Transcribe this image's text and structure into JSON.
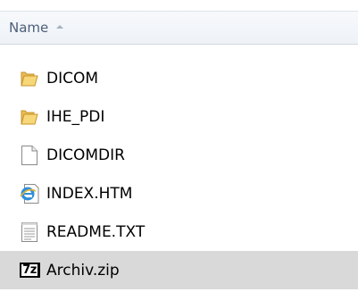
{
  "header": {
    "column_name": "Name"
  },
  "files": [
    {
      "name": "DICOM",
      "icon": "folder-icon"
    },
    {
      "name": "IHE_PDI",
      "icon": "folder-icon"
    },
    {
      "name": "DICOMDIR",
      "icon": "file-icon"
    },
    {
      "name": "INDEX.HTM",
      "icon": "html-file-icon"
    },
    {
      "name": "README.TXT",
      "icon": "text-file-icon"
    },
    {
      "name": "Archiv.zip",
      "icon": "7zip-archive-icon",
      "selected": true
    }
  ],
  "colors": {
    "selected_row": "#d9d9d9",
    "header_text": "#4c607a",
    "folder": "#e8b84a"
  }
}
